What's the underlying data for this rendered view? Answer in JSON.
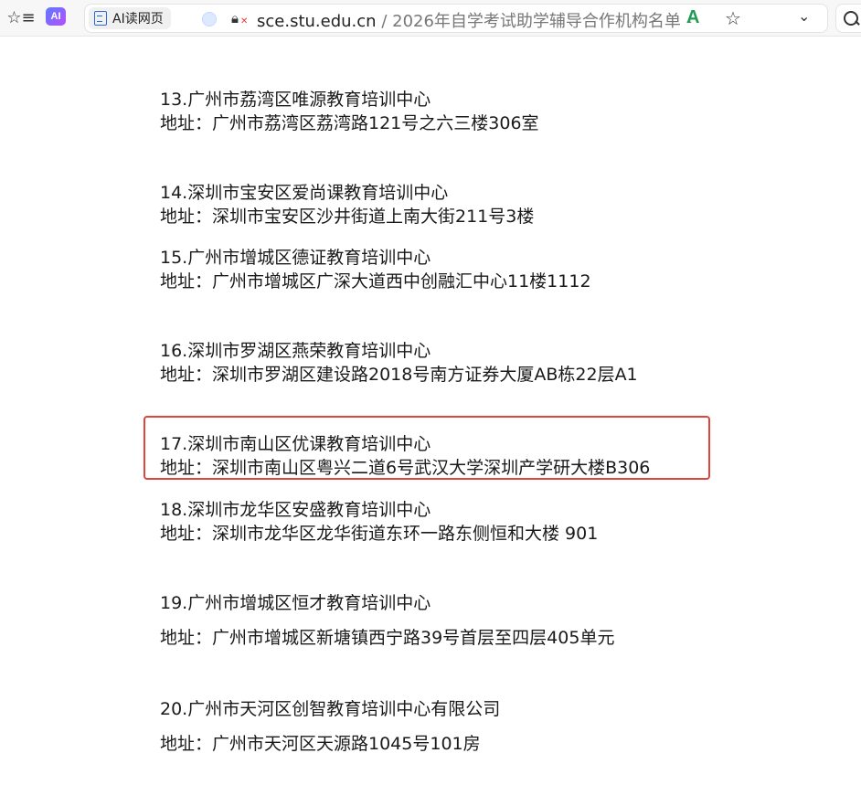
{
  "toolbar": {
    "ai_read_label": "AI读网页",
    "ai_logo_text": "AI",
    "url_domain": "sce.stu.edu.cn",
    "url_separator": "/",
    "page_title": "2026年自学考试助学辅导合作机构名单 -",
    "read_aloud_glyph": "A",
    "icons": [
      "favorites-icon",
      "ai-logo-icon",
      "doc-icon",
      "globe-icon",
      "lock-icon",
      "read-aloud-icon",
      "star-icon",
      "chevron-down-icon",
      "search-icon"
    ]
  },
  "entries": [
    {
      "name": "13.广州市荔湾区唯源教育培训中心",
      "address": "地址：广州市荔湾区荔湾路121号之六三楼306室"
    },
    {
      "name": "14.深圳市宝安区爱尚课教育培训中心",
      "address": "地址：深圳市宝安区沙井街道上南大街211号3楼"
    },
    {
      "name": "15.广州市增城区德证教育培训中心",
      "address": "地址：广州市增城区广深大道西中创融汇中心11楼1112"
    },
    {
      "name": "16.深圳市罗湖区燕荣教育培训中心",
      "address": "地址：深圳市罗湖区建设路2018号南方证券大厦AB栋22层A1"
    },
    {
      "name": "17.深圳市南山区优课教育培训中心",
      "address": "地址：深圳市南山区粤兴二道6号武汉大学深圳产学研大楼B306"
    },
    {
      "name": "18.深圳市龙华区安盛教育培训中心",
      "address": "地址：深圳市龙华区龙华街道东环一路东侧恒和大楼 901"
    },
    {
      "name": "19.广州市增城区恒才教育培训中心",
      "address": "地址：广州市增城区新塘镇西宁路39号首层至四层405单元"
    },
    {
      "name": "20.广州市天河区创智教育培训中心有限公司",
      "address": "地址：广州市天河区天源路1045号101房"
    }
  ],
  "colors": {
    "highlight": "#e0443b",
    "text": "#1a1a1a"
  }
}
